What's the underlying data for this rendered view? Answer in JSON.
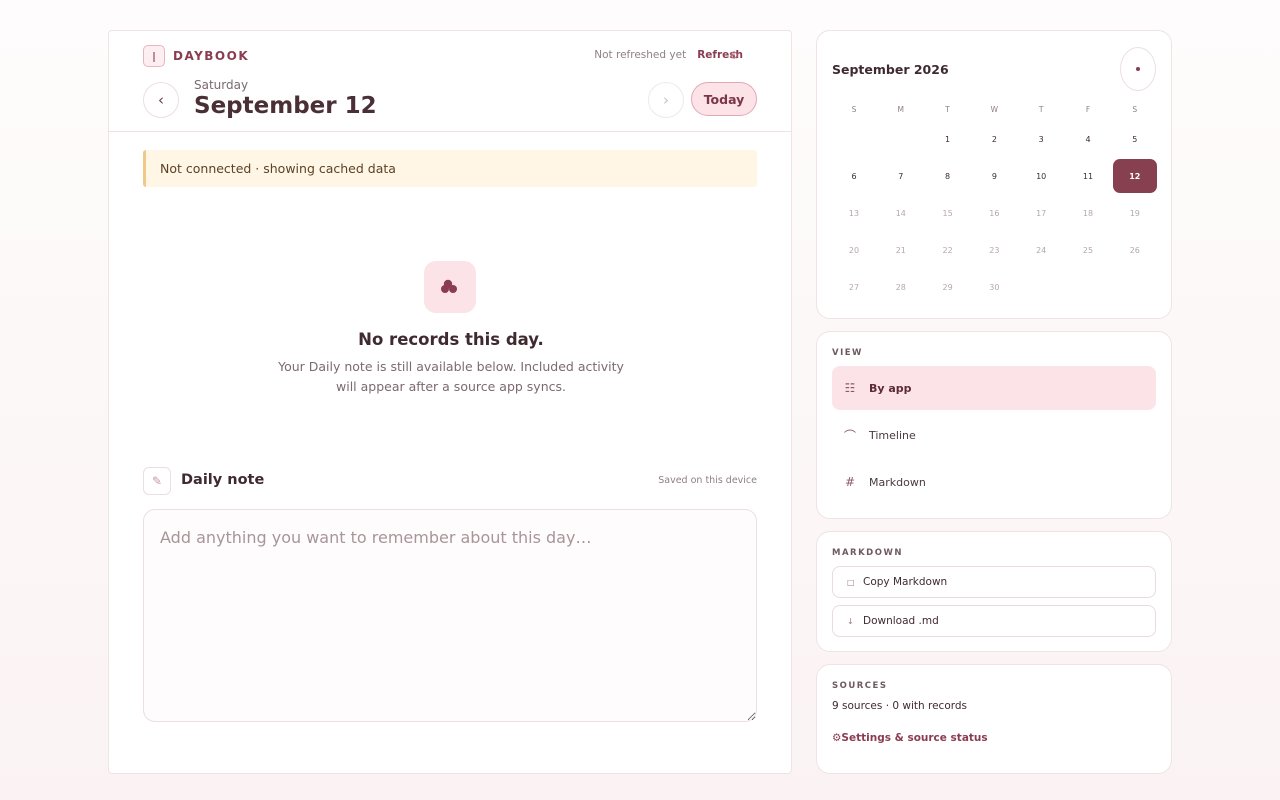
{
  "brand": {
    "logo_glyph": "ǀ",
    "name": "DAYBOOK"
  },
  "header": {
    "refresh_status": "Not refreshed yet",
    "refresh_label": "Refresh",
    "sync_icon": "⚙",
    "prev_glyph": "‹",
    "next_glyph": "›",
    "weekday": "Saturday",
    "date": "September 12",
    "today_label": "Today"
  },
  "banner": {
    "text": "Not connected · showing cached data"
  },
  "empty_state": {
    "title": "No records this day.",
    "description": "Your Daily note is still available below. Included activity will appear after a source app syncs."
  },
  "daily_note": {
    "icon": "✎",
    "title": "Daily note",
    "saved_status": "Saved on this device",
    "placeholder": "Add anything you want to remember about this day…",
    "value": ""
  },
  "calendar": {
    "title": "September 2026",
    "weekdays": [
      "S",
      "M",
      "T",
      "W",
      "T",
      "F",
      "S"
    ],
    "first_weekday_index": 2,
    "days_in_month": 30,
    "selected_day": 12,
    "last_active_day": 12
  },
  "view": {
    "label": "VIEW",
    "items": [
      {
        "label": "By app",
        "icon": "☷",
        "active": true
      },
      {
        "label": "Timeline",
        "icon": "⌒",
        "active": false
      },
      {
        "label": "Markdown",
        "icon": "#",
        "active": false
      }
    ]
  },
  "markdown": {
    "label": "MARKDOWN",
    "copy": {
      "icon": "□",
      "label": "Copy Markdown"
    },
    "download": {
      "icon": "↓",
      "label": "Download .md"
    }
  },
  "sources": {
    "label": "SOURCES",
    "summary": "9 sources · 0 with records",
    "settings_link": "⚙Settings & source status"
  },
  "colors": {
    "accent": "#8a3c52",
    "accent_soft": "#fbe3e8",
    "selected_day_bg": "#87404f",
    "banner_bg": "#fff6e6",
    "banner_border": "#f0c98a"
  }
}
